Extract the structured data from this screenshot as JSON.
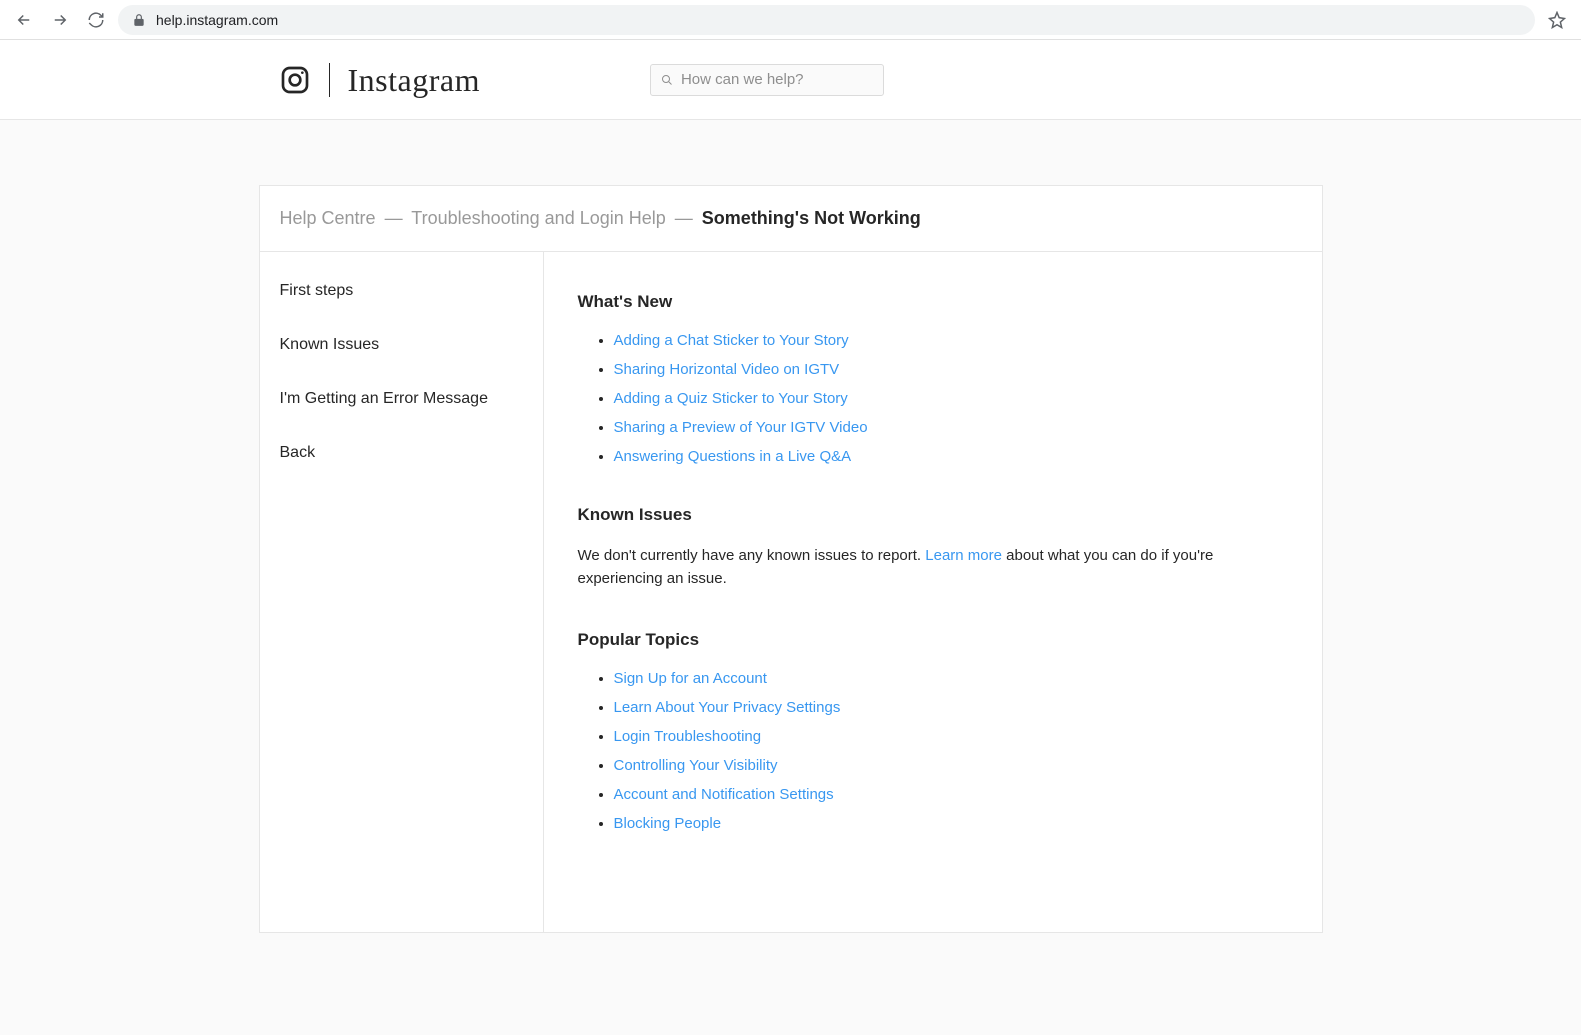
{
  "browser": {
    "url": "help.instagram.com"
  },
  "header": {
    "wordmark": "Instagram",
    "search_placeholder": "How can we help?"
  },
  "breadcrumb": {
    "items": [
      "Help Centre",
      "Troubleshooting and Login Help"
    ],
    "current": "Something's Not Working",
    "separator": "—"
  },
  "sidebar": {
    "items": [
      {
        "label": "First steps"
      },
      {
        "label": "Known Issues"
      },
      {
        "label": "I'm Getting an Error Message"
      },
      {
        "label": "Back"
      }
    ]
  },
  "main": {
    "whats_new": {
      "title": "What's New",
      "links": [
        "Adding a Chat Sticker to Your Story",
        "Sharing Horizontal Video on IGTV",
        "Adding a Quiz Sticker to Your Story",
        "Sharing a Preview of Your IGTV Video",
        "Answering Questions in a Live Q&A"
      ]
    },
    "known_issues": {
      "title": "Known Issues",
      "text_before": "We don't currently have any known issues to report. ",
      "link": "Learn more",
      "text_after": " about what you can do if you're experiencing an issue."
    },
    "popular_topics": {
      "title": "Popular Topics",
      "links": [
        "Sign Up for an Account",
        "Learn About Your Privacy Settings",
        "Login Troubleshooting",
        "Controlling Your Visibility",
        "Account and Notification Settings",
        "Blocking People"
      ]
    }
  }
}
